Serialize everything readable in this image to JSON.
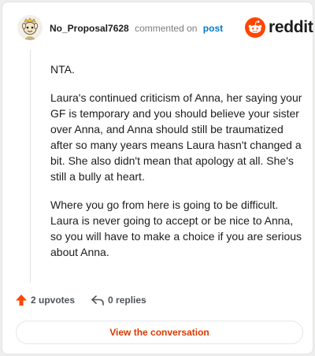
{
  "header": {
    "username": "No_Proposal7628",
    "action_text": "commented on",
    "post_link": "post",
    "brand": "reddit"
  },
  "comment": {
    "paragraphs": [
      "NTA.",
      "Laura's continued criticism of Anna, her saying your GF is temporary and you should believe your sister over Anna, and Anna should still be traumatized after so many years means Laura hasn't changed a bit. She also didn't mean that apology at all. She's still a bully at heart.",
      "Where you go from here is going to be difficult. Laura is never going to accept or be nice to Anna, so you will have to make a choice if you are serious about Anna."
    ]
  },
  "actions": {
    "upvotes": "2 upvotes",
    "replies": "0 replies"
  },
  "footer": {
    "view_button": "View the conversation"
  },
  "colors": {
    "brand_orange": "#ff4500",
    "upvote": "#ff4500",
    "link_blue": "#0079d3",
    "button_text": "#d93a00"
  },
  "icons": {
    "avatar": "user-avatar",
    "logo": "reddit-snoo-icon",
    "upvote": "upvote-arrow-icon",
    "reply": "reply-arrow-icon"
  }
}
